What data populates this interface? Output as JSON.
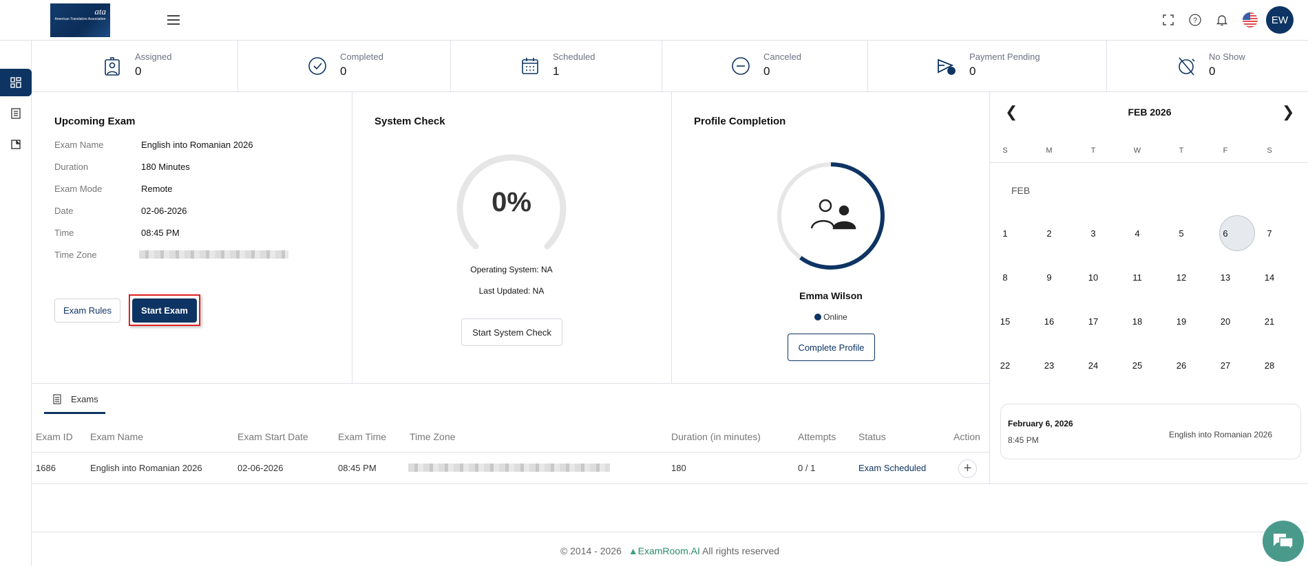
{
  "header": {
    "logo_text": "American Translators Association",
    "logo_tagline": "The Voice of Interpreters and Translators",
    "logo_mark": "ata",
    "avatar_initials": "EW",
    "icons": [
      "menu-icon",
      "fullscreen-icon",
      "help-icon",
      "bell-icon",
      "us-flag-icon"
    ]
  },
  "sidebar": {
    "items": [
      {
        "icon": "dashboard-icon",
        "active": true
      },
      {
        "icon": "list-icon",
        "active": false
      },
      {
        "icon": "bookmark-icon",
        "active": false
      }
    ]
  },
  "stats": [
    {
      "label": "Assigned",
      "value": "0",
      "icon": "badge-icon"
    },
    {
      "label": "Completed",
      "value": "0",
      "icon": "check-circle-icon"
    },
    {
      "label": "Scheduled",
      "value": "1",
      "icon": "calendar-icon"
    },
    {
      "label": "Canceled",
      "value": "0",
      "icon": "minus-circle-icon"
    },
    {
      "label": "Payment Pending",
      "value": "0",
      "icon": "payment-clock-icon"
    },
    {
      "label": "No Show",
      "value": "0",
      "icon": "alarm-off-icon"
    }
  ],
  "upcoming": {
    "title": "Upcoming Exam",
    "rows": [
      {
        "label": "Exam Name",
        "value": "English into Romanian 2026"
      },
      {
        "label": "Duration",
        "value": "180 Minutes"
      },
      {
        "label": "Exam Mode",
        "value": "Remote"
      },
      {
        "label": "Date",
        "value": "02-06-2026"
      },
      {
        "label": "Time",
        "value": "08:45 PM"
      },
      {
        "label": "Time Zone",
        "value": ""
      }
    ],
    "rules_label": "Exam Rules",
    "start_label": "Start Exam"
  },
  "system_check": {
    "title": "System Check",
    "percent": "0%",
    "progress": 0,
    "os": "Operating System: NA",
    "updated": "Last Updated: NA",
    "button": "Start System Check"
  },
  "profile": {
    "title": "Profile Completion",
    "progress": 0.6,
    "name": "Emma Wilson",
    "status": "Online",
    "button": "Complete Profile"
  },
  "calendar": {
    "month": "FEB 2026",
    "month_label": "FEB",
    "dow": [
      "S",
      "M",
      "T",
      "W",
      "T",
      "F",
      "S"
    ],
    "weeks": [
      [
        "1",
        "2",
        "3",
        "4",
        "5",
        "6",
        "7"
      ],
      [
        "8",
        "9",
        "10",
        "11",
        "12",
        "13",
        "14"
      ],
      [
        "15",
        "16",
        "17",
        "18",
        "19",
        "20",
        "21"
      ],
      [
        "22",
        "23",
        "24",
        "25",
        "26",
        "27",
        "28"
      ]
    ],
    "selected": "6",
    "event": {
      "date": "February 6, 2026",
      "time": "8:45 PM",
      "name": "English into Romanian 2026"
    }
  },
  "exams": {
    "tab": "Exams",
    "columns": [
      "Exam ID",
      "Exam Name",
      "Exam Start Date",
      "Exam Time",
      "Time Zone",
      "Duration (in minutes)",
      "Attempts",
      "Status",
      "Action"
    ],
    "rows": [
      {
        "id": "1686",
        "name": "English into Romanian 2026",
        "date": "02-06-2026",
        "time": "08:45 PM",
        "tz": "",
        "duration": "180",
        "attempts": "0 / 1",
        "status": "Exam Scheduled"
      }
    ]
  },
  "footer": {
    "copyright": "© 2014 - 2026",
    "brand": "ExamRoom.AI",
    "rights": "All rights reserved"
  },
  "colors": {
    "primary": "#0d3463",
    "chat": "#4a9a8c",
    "highlight": "#e02020"
  }
}
